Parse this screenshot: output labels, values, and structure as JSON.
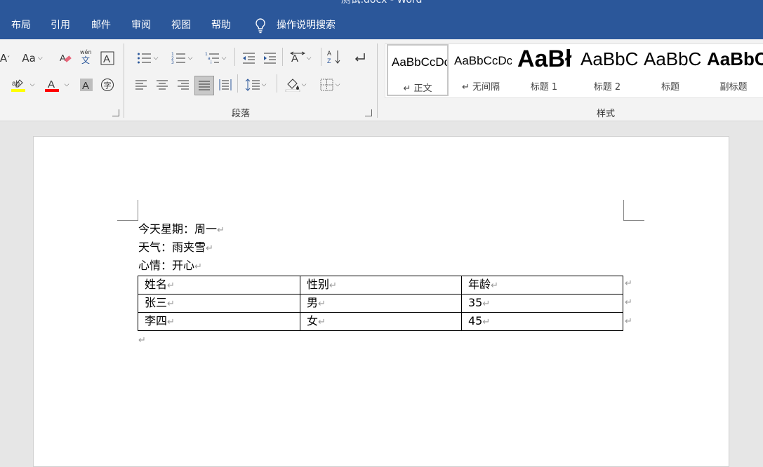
{
  "titlebar": {
    "title": "测试.docx  -  Word",
    "bg": "#2b579a"
  },
  "menu": {
    "items": [
      "布局",
      "引用",
      "邮件",
      "审阅",
      "视图",
      "帮助"
    ],
    "search_label": "操作说明搜索"
  },
  "ribbon": {
    "font_size_label": "Aa",
    "paragraph_group_label": "段落",
    "styles_group_label": "样式",
    "styles": [
      {
        "sample": "AaBbCcDc",
        "name": "↵ 正文",
        "selected": true
      },
      {
        "sample": "AaBbCcDc",
        "name": "↵ 无间隔"
      },
      {
        "sample": "AaBł",
        "name": "标题 1"
      },
      {
        "sample": "AaBbC",
        "name": "标题 2"
      },
      {
        "sample": "AaBbC",
        "name": "标题"
      },
      {
        "sample": "AaBbC",
        "name": "副标题"
      }
    ],
    "highlight_color": "#ffff00",
    "font_color": "#ff0000"
  },
  "document": {
    "lines": [
      "今天星期：周一",
      "天气：雨夹雪",
      "心情：开心"
    ],
    "paragraph_mark": "↵",
    "table": {
      "header": [
        "姓名",
        "性别",
        "年龄"
      ],
      "rows": [
        [
          "张三",
          "男",
          "35"
        ],
        [
          "李四",
          "女",
          "45"
        ]
      ]
    }
  }
}
